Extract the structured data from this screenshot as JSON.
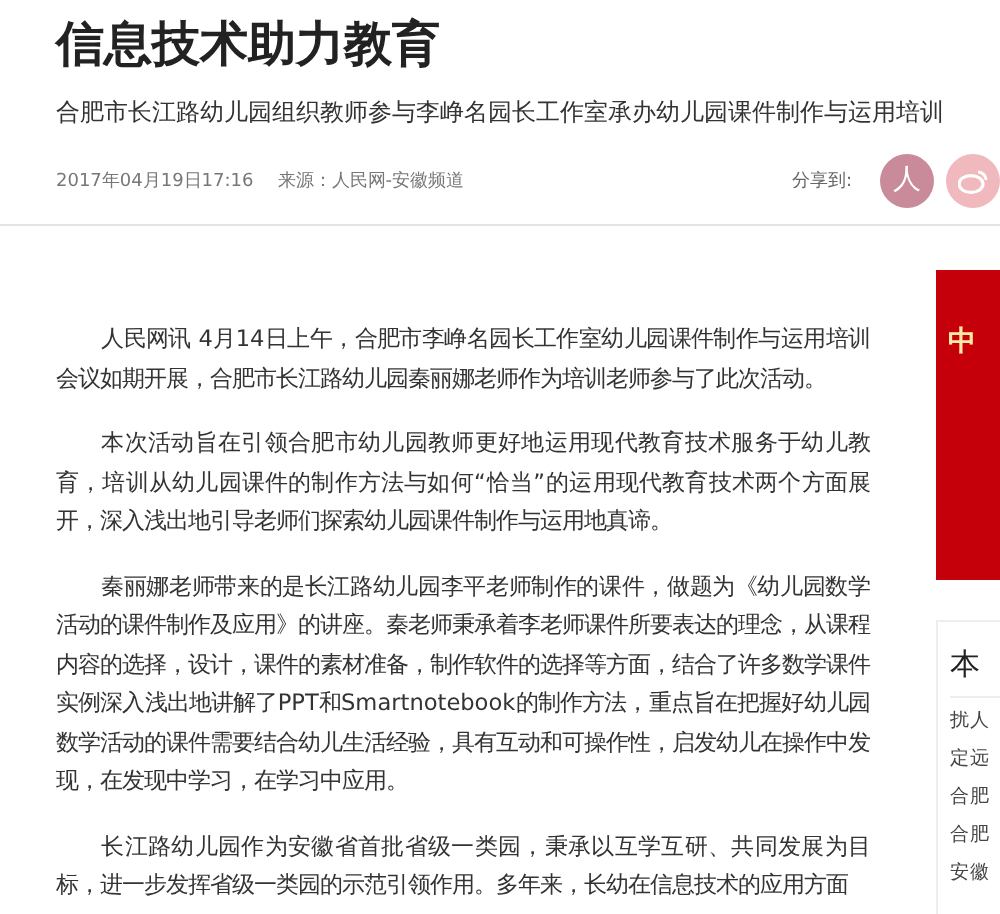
{
  "article": {
    "title": "信息技术助力教育",
    "subtitle": "合肥市长江路幼儿园组织教师参与李峥名园长工作室承办幼儿园课件制作与运用培训",
    "date": "2017年04月19日17:16",
    "source": "来源：人民网-安徽频道",
    "share_label": "分享到:",
    "share_buttons": [
      {
        "kind": "glyph",
        "label": "人"
      },
      {
        "kind": "weibo"
      }
    ],
    "paragraphs": [
      "人民网讯 4月14日上午，合肥市李峥名园长工作室幼儿园课件制作与运用培训会议如期开展，合肥市长江路幼儿园秦丽娜老师作为培训老师参与了此次活动。",
      "本次活动旨在引领合肥市幼儿园教师更好地运用现代教育技术服务于幼儿教育，培训从幼儿园课件的制作方法与如何“恰当”的运用现代教育技术两个方面展开，深入浅出地引导老师们探索幼儿园课件制作与运用地真谛。",
      "秦丽娜老师带来的是长江路幼儿园李平老师制作的课件，做题为《幼儿园数学活动的课件制作及应用》的讲座。秦老师秉承着李老师课件所要表达的理念，从课程内容的选择，设计，课件的素材准备，制作软件的选择等方面，结合了许多数学课件实例深入浅出地讲解了PPT和Smartnotebook的制作方法，重点旨在把握好幼儿园数学活动的课件需要结合幼儿生活经验，具有互动和可操作性，启发幼儿在操作中发现，在发现中学习，在学习中应用。",
      "长江路幼儿园作为安徽省首批省级一类园，秉承以互学互研、共同发展为目标，进一步发挥省级一类园的示范引领作用。多年来，长幼在信息技术的应用方面"
    ]
  },
  "sidebar": {
    "banner": {
      "title": "中"
    },
    "list": {
      "title": "本",
      "items": [
        "扰人",
        "定远",
        "合肥",
        "合肥",
        "安徽"
      ]
    }
  }
}
